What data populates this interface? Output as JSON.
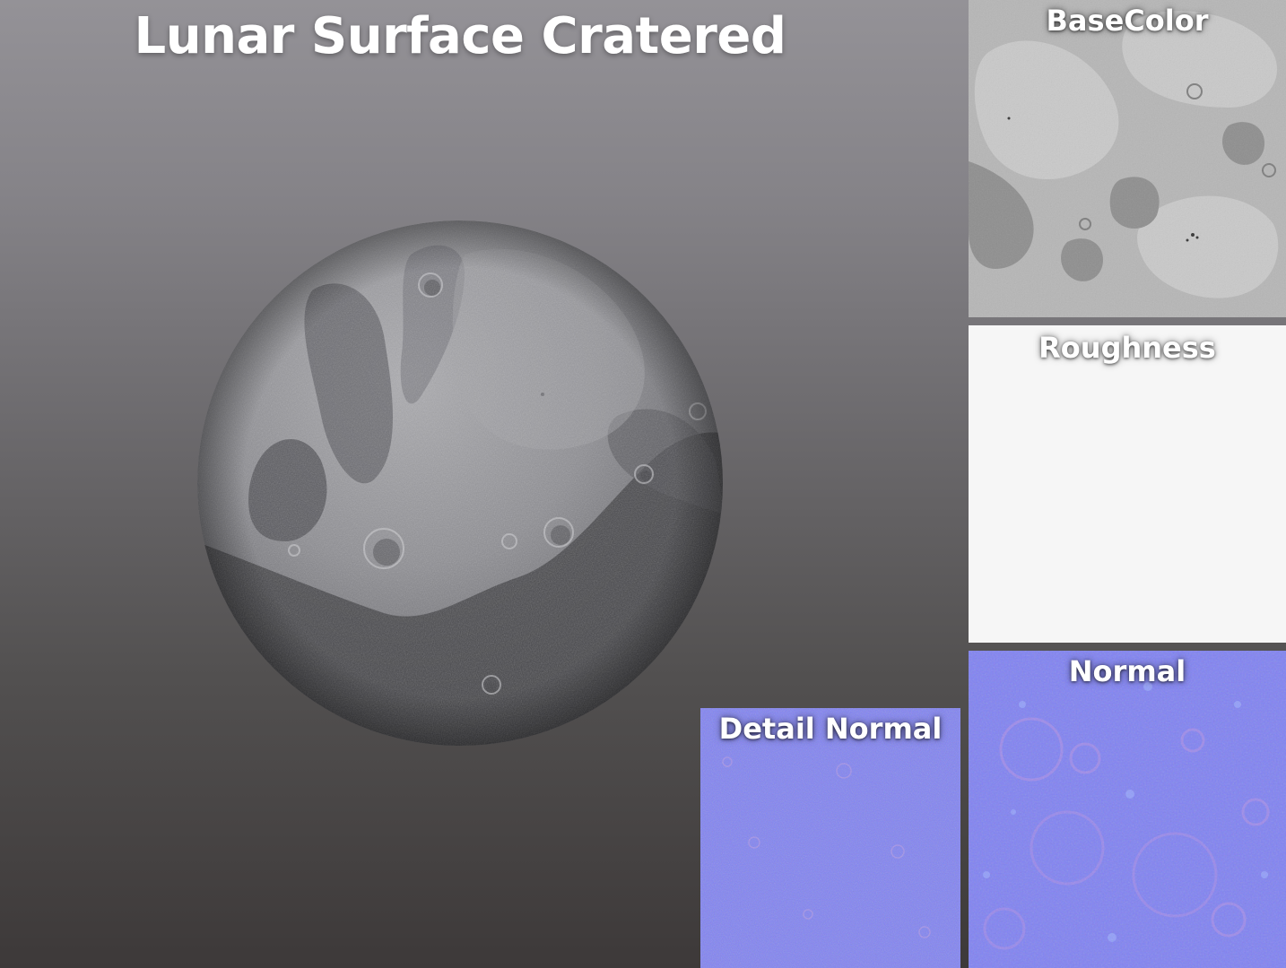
{
  "title": "Lunar Surface Cratered",
  "panels": {
    "basecolor": {
      "label": "BaseColor"
    },
    "roughness": {
      "label": "Roughness"
    },
    "normal": {
      "label": "Normal"
    },
    "detail_normal": {
      "label": "Detail Normal"
    }
  },
  "colors": {
    "background_top": "#949297",
    "background_bottom": "#3d3939",
    "sphere_light": "#a9a9ad",
    "sphere_dark": "#3e3e42",
    "normal_base": "#8183f2",
    "roughness_base": "#f6f6f6",
    "basecolor_base": "#b4b4b4"
  }
}
